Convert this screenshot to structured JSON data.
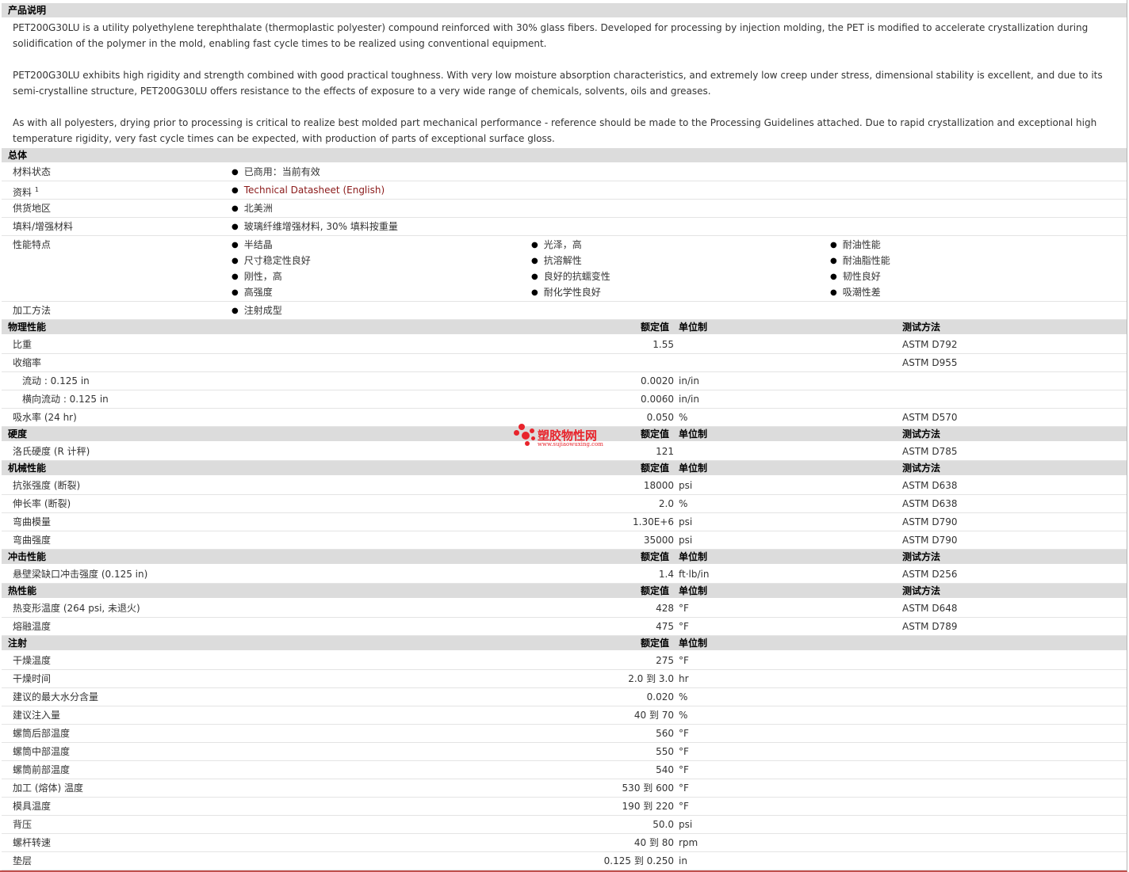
{
  "desc_header": "产品说明",
  "paragraphs": [
    "PET200G30LU is a utility polyethylene terephthalate (thermoplastic polyester) compound reinforced with 30% glass fibers. Developed for processing by injection molding, the PET is modified to accelerate crystallization during solidification of the polymer in the mold, enabling fast cycle times to be realized using conventional equipment.",
    "PET200G30LU exhibits high rigidity and strength combined with good practical toughness. With very low moisture absorption characteristics, and extremely low creep under stress, dimensional stability is excellent, and due to its semi-crystalline structure, PET200G30LU offers resistance to the effects of exposure to a very wide range of chemicals, solvents, oils and greases.",
    "As with all polyesters, drying prior to processing is critical to realize best molded part mechanical performance - reference should be made to the Processing Guidelines attached. Due to rapid crystallization and exceptional high temperature rigidity, very fast cycle times can be expected, with production of parts of exceptional surface gloss."
  ],
  "general": {
    "header": "总体",
    "material_status_label": "材料状态",
    "material_status": "已商用：当前有效",
    "docs_label": "资料",
    "docs_sup": "1",
    "docs_link": "Technical Datasheet (English)",
    "region_label": "供货地区",
    "region": "北美洲",
    "filler_label": "填料/增强材料",
    "filler": "玻璃纤维增强材料, 30% 填料按重量",
    "features_label": "性能特点",
    "features": [
      "半结晶",
      "光泽，高",
      "耐油性能",
      "尺寸稳定性良好",
      "抗溶解性",
      "耐油脂性能",
      "刚性，高",
      "良好的抗蠕变性",
      "韧性良好",
      "高强度",
      "耐化学性良好",
      "吸潮性差"
    ],
    "process_label": "加工方法",
    "process": "注射成型"
  },
  "col_headers": {
    "nominal": "额定值",
    "unit": "单位制",
    "test": "测试方法"
  },
  "sections": [
    {
      "header": "物理性能",
      "show_test": true,
      "rows": [
        {
          "label": "比重",
          "value": "1.55",
          "unit": "",
          "test": "ASTM D792",
          "sub": false
        },
        {
          "label": "收缩率",
          "value": "",
          "unit": "",
          "test": "ASTM D955",
          "sub": false
        },
        {
          "label": "流动 : 0.125 in",
          "value": "0.0020",
          "unit": "in/in",
          "test": "",
          "sub": true
        },
        {
          "label": "横向流动 : 0.125 in",
          "value": "0.0060",
          "unit": "in/in",
          "test": "",
          "sub": true
        },
        {
          "label": "吸水率 (24 hr)",
          "value": "0.050",
          "unit": "%",
          "test": "ASTM D570",
          "sub": false
        }
      ]
    },
    {
      "header": "硬度",
      "show_test": true,
      "rows": [
        {
          "label": "洛氏硬度 (R 计秤)",
          "value": "121",
          "unit": "",
          "test": "ASTM D785",
          "sub": false
        }
      ]
    },
    {
      "header": "机械性能",
      "show_test": true,
      "rows": [
        {
          "label": "抗张强度 (断裂)",
          "value": "18000",
          "unit": "psi",
          "test": "ASTM D638",
          "sub": false
        },
        {
          "label": "伸长率 (断裂)",
          "value": "2.0",
          "unit": "%",
          "test": "ASTM D638",
          "sub": false
        },
        {
          "label": "弯曲模量",
          "value": "1.30E+6",
          "unit": "psi",
          "test": "ASTM D790",
          "sub": false
        },
        {
          "label": "弯曲强度",
          "value": "35000",
          "unit": "psi",
          "test": "ASTM D790",
          "sub": false
        }
      ]
    },
    {
      "header": "冲击性能",
      "show_test": true,
      "rows": [
        {
          "label": "悬壁梁缺口冲击强度 (0.125 in)",
          "value": "1.4",
          "unit": "ft·lb/in",
          "test": "ASTM D256",
          "sub": false
        }
      ]
    },
    {
      "header": "热性能",
      "show_test": true,
      "rows": [
        {
          "label": "热变形温度 (264 psi, 未退火)",
          "value": "428",
          "unit": "°F",
          "test": "ASTM D648",
          "sub": false
        },
        {
          "label": "熔融温度",
          "value": "475",
          "unit": "°F",
          "test": "ASTM D789",
          "sub": false
        }
      ]
    },
    {
      "header": "注射",
      "show_test": false,
      "rows": [
        {
          "label": "干燥温度",
          "value": "275",
          "unit": "°F",
          "test": "",
          "sub": false
        },
        {
          "label": "干燥时间",
          "value": "2.0 到  3.0",
          "unit": "hr",
          "test": "",
          "sub": false
        },
        {
          "label": "建议的最大水分含量",
          "value": "0.020",
          "unit": "%",
          "test": "",
          "sub": false
        },
        {
          "label": "建议注入量",
          "value": "40 到  70",
          "unit": "%",
          "test": "",
          "sub": false
        },
        {
          "label": "螺筒后部温度",
          "value": "560",
          "unit": "°F",
          "test": "",
          "sub": false
        },
        {
          "label": "螺筒中部温度",
          "value": "550",
          "unit": "°F",
          "test": "",
          "sub": false
        },
        {
          "label": "螺筒前部温度",
          "value": "540",
          "unit": "°F",
          "test": "",
          "sub": false
        },
        {
          "label": "加工 (熔体) 温度",
          "value": "530 到  600",
          "unit": "°F",
          "test": "",
          "sub": false
        },
        {
          "label": "模具温度",
          "value": "190 到  220",
          "unit": "°F",
          "test": "",
          "sub": false
        },
        {
          "label": "背压",
          "value": "50.0",
          "unit": "psi",
          "test": "",
          "sub": false
        },
        {
          "label": "螺杆转速",
          "value": "40 到  80",
          "unit": "rpm",
          "test": "",
          "sub": false
        },
        {
          "label": "垫层",
          "value": "0.125 到  0.250",
          "unit": "in",
          "test": "",
          "sub": false
        }
      ]
    }
  ],
  "watermark": {
    "name": "塑胶物性网",
    "url": "www.sujiaowuxing.com",
    "color": "#e8242c"
  }
}
